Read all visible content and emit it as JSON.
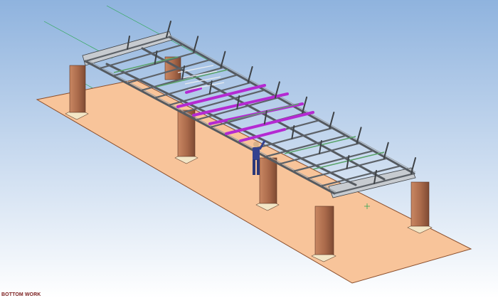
{
  "viewport": {
    "view_name": "BOTTOM WORK",
    "background_top": "#8fb3de",
    "background_bottom": "#ffffff",
    "floor_color": "#f8c49a",
    "floor_edge_color": "#8a4d2a",
    "column_color": "#a9694a",
    "column_base_color": "#f3e6c6",
    "steel_color": "#555a60",
    "highlight_member_color": "#b42ad2",
    "green_member_color": "#5aa36a",
    "guide_line_color": "#2ea855",
    "worker_color": "#34428f"
  }
}
